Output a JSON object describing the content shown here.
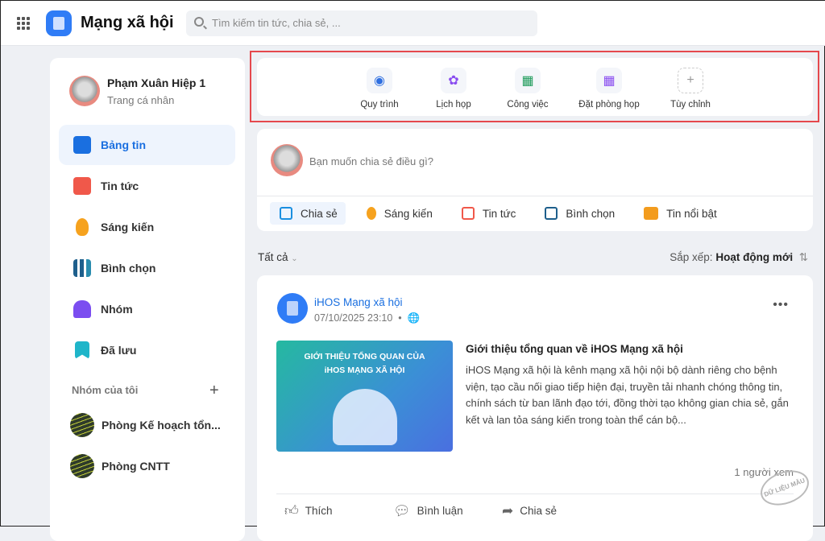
{
  "header": {
    "app_title": "Mạng xã hội",
    "search_placeholder": "Tìm kiếm tin tức, chia sẻ, ..."
  },
  "profile": {
    "name": "Phạm Xuân Hiệp 1",
    "subtitle": "Trang cá nhân"
  },
  "sidebar": {
    "items": [
      {
        "label": "Bảng tin",
        "color": "#1a6fe0"
      },
      {
        "label": "Tin tức",
        "color": "#f0584a"
      },
      {
        "label": "Sáng kiến",
        "color": "#f6a21e"
      },
      {
        "label": "Bình chọn",
        "color": "#1e5f8c"
      },
      {
        "label": "Nhóm",
        "color": "#7b4df0"
      },
      {
        "label": "Đã lưu",
        "color": "#1fb5c9"
      }
    ],
    "groups_title": "Nhóm của tôi",
    "groups": [
      "Phòng Kế hoạch tổn...",
      "Phòng CNTT"
    ]
  },
  "quick_access": [
    {
      "label": "Quy trình",
      "icon": "◉",
      "color": "#2f6fe0"
    },
    {
      "label": "Lịch họp",
      "icon": "✿",
      "color": "#8a4df0"
    },
    {
      "label": "Công việc",
      "icon": "▦",
      "color": "#1e9b5a"
    },
    {
      "label": "Đặt phòng họp",
      "icon": "▦",
      "color": "#8a4df0"
    },
    {
      "label": "Tùy chỉnh",
      "icon": "+",
      "color": "#999"
    }
  ],
  "composer": {
    "placeholder": "Bạn muốn chia sẻ điều gì?",
    "buttons": [
      {
        "label": "Chia sẻ",
        "color": "#1a8fe0"
      },
      {
        "label": "Sáng kiến",
        "color": "#f6a21e"
      },
      {
        "label": "Tin tức",
        "color": "#f0584a"
      },
      {
        "label": "Bình chọn",
        "color": "#1e5f8c"
      },
      {
        "label": "Tin nổi bật",
        "color": "#f39c1e"
      }
    ]
  },
  "feed": {
    "filter": "Tất cả",
    "sort_label": "Sắp xếp:",
    "sort_value": "Hoạt động mới"
  },
  "post": {
    "author": "iHOS Mạng xã hội",
    "time": "07/10/2025 23:10",
    "image_caption": "GIỚI THIỆU TỔNG QUAN CỦA iHOS MẠNG XÃ HỘI",
    "title": "Giới thiệu tổng quan về iHOS Mạng xã hội",
    "body": "iHOS Mạng xã hội là kênh mạng xã hội nội bộ dành riêng cho bệnh viện, tạo cầu nối giao tiếp hiện đại, truyền tải nhanh chóng thông tin, chính sách từ ban lãnh đạo tới, đồng thời tạo không gian chia sẻ, gắn kết và lan tỏa sáng kiến trong toàn thể cán bộ...",
    "views": "1 người xem",
    "actions": [
      "Thích",
      "Bình luận",
      "Chia sẻ"
    ]
  },
  "watermark": "DỮ LIỆU MẪU"
}
